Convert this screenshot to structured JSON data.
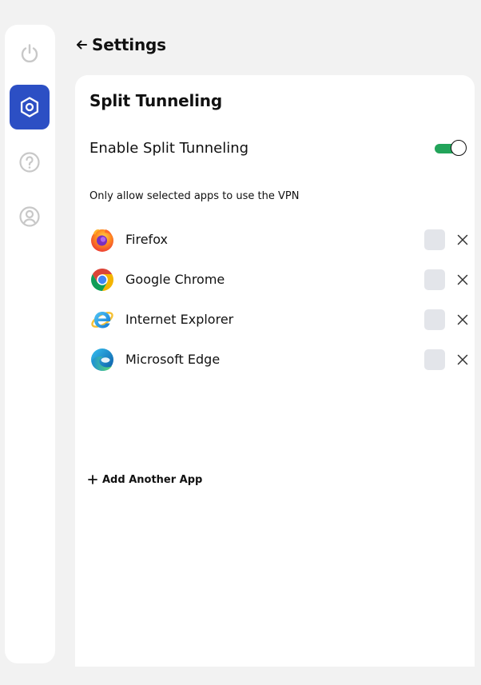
{
  "sidebar": {
    "items": [
      {
        "id": "power",
        "icon": "power-icon",
        "active": false
      },
      {
        "id": "settings",
        "icon": "gear-icon",
        "active": true
      },
      {
        "id": "help",
        "icon": "question-icon",
        "active": false
      },
      {
        "id": "account",
        "icon": "user-icon",
        "active": false
      }
    ],
    "active_color": "#2c4fc4",
    "inactive_icon_color": "#c8c8c8"
  },
  "header": {
    "back_icon": "arrow-left-icon",
    "title": "Settings"
  },
  "split_tunneling": {
    "title": "Split Tunneling",
    "toggle_label": "Enable Split Tunneling",
    "toggle_on": true,
    "toggle_color": "#22a45a",
    "description": "Only allow selected apps to use the VPN",
    "apps": [
      {
        "name": "Firefox",
        "icon": "firefox-icon",
        "checked": false
      },
      {
        "name": "Google Chrome",
        "icon": "chrome-icon",
        "checked": false
      },
      {
        "name": "Internet Explorer",
        "icon": "internet-explorer-icon",
        "checked": false
      },
      {
        "name": "Microsoft Edge",
        "icon": "edge-icon",
        "checked": false
      }
    ],
    "add_app_label": "Add Another App"
  }
}
